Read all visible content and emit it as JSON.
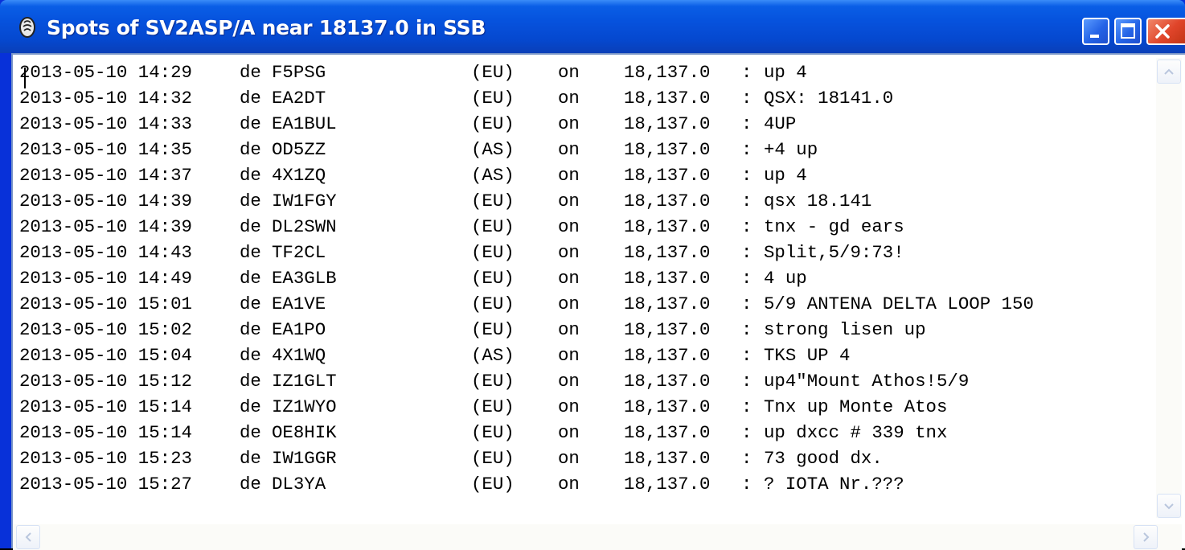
{
  "window": {
    "title": "Spots of SV2ASP/A near 18137.0 in SSB",
    "app_icon": "radio-cluster-icon",
    "controls": [
      "minimize-icon",
      "maximize-icon",
      "close-icon"
    ]
  },
  "spots": [
    {
      "datetime": "2013-05-10 14:29",
      "de": "de",
      "call": "F5PSG",
      "continent": "(EU)",
      "on": "on",
      "freq": "18,137.0",
      "sep": ":",
      "comment": "up 4"
    },
    {
      "datetime": "2013-05-10 14:32",
      "de": "de",
      "call": "EA2DT",
      "continent": "(EU)",
      "on": "on",
      "freq": "18,137.0",
      "sep": ":",
      "comment": "QSX: 18141.0"
    },
    {
      "datetime": "2013-05-10 14:33",
      "de": "de",
      "call": "EA1BUL",
      "continent": "(EU)",
      "on": "on",
      "freq": "18,137.0",
      "sep": ":",
      "comment": "4UP"
    },
    {
      "datetime": "2013-05-10 14:35",
      "de": "de",
      "call": "OD5ZZ",
      "continent": "(AS)",
      "on": "on",
      "freq": "18,137.0",
      "sep": ":",
      "comment": "+4 up"
    },
    {
      "datetime": "2013-05-10 14:37",
      "de": "de",
      "call": "4X1ZQ",
      "continent": "(AS)",
      "on": "on",
      "freq": "18,137.0",
      "sep": ":",
      "comment": "up 4"
    },
    {
      "datetime": "2013-05-10 14:39",
      "de": "de",
      "call": "IW1FGY",
      "continent": "(EU)",
      "on": "on",
      "freq": "18,137.0",
      "sep": ":",
      "comment": "qsx 18.141"
    },
    {
      "datetime": "2013-05-10 14:39",
      "de": "de",
      "call": "DL2SWN",
      "continent": "(EU)",
      "on": "on",
      "freq": "18,137.0",
      "sep": ":",
      "comment": "tnx - gd ears"
    },
    {
      "datetime": "2013-05-10 14:43",
      "de": "de",
      "call": "TF2CL",
      "continent": "(EU)",
      "on": "on",
      "freq": "18,137.0",
      "sep": ":",
      "comment": "Split,5/9:73!"
    },
    {
      "datetime": "2013-05-10 14:49",
      "de": "de",
      "call": "EA3GLB",
      "continent": "(EU)",
      "on": "on",
      "freq": "18,137.0",
      "sep": ":",
      "comment": "4 up"
    },
    {
      "datetime": "2013-05-10 15:01",
      "de": "de",
      "call": "EA1VE",
      "continent": "(EU)",
      "on": "on",
      "freq": "18,137.0",
      "sep": ":",
      "comment": "5/9 ANTENA DELTA LOOP 150"
    },
    {
      "datetime": "2013-05-10 15:02",
      "de": "de",
      "call": "EA1PO",
      "continent": "(EU)",
      "on": "on",
      "freq": "18,137.0",
      "sep": ":",
      "comment": "strong lisen up"
    },
    {
      "datetime": "2013-05-10 15:04",
      "de": "de",
      "call": "4X1WQ",
      "continent": "(AS)",
      "on": "on",
      "freq": "18,137.0",
      "sep": ":",
      "comment": "TKS UP 4"
    },
    {
      "datetime": "2013-05-10 15:12",
      "de": "de",
      "call": "IZ1GLT",
      "continent": "(EU)",
      "on": "on",
      "freq": "18,137.0",
      "sep": ":",
      "comment": "up4\"Mount Athos!5/9"
    },
    {
      "datetime": "2013-05-10 15:14",
      "de": "de",
      "call": "IZ1WYO",
      "continent": "(EU)",
      "on": "on",
      "freq": "18,137.0",
      "sep": ":",
      "comment": "Tnx up Monte Atos"
    },
    {
      "datetime": "2013-05-10 15:14",
      "de": "de",
      "call": "OE8HIK",
      "continent": "(EU)",
      "on": "on",
      "freq": "18,137.0",
      "sep": ":",
      "comment": "up dxcc # 339 tnx"
    },
    {
      "datetime": "2013-05-10 15:23",
      "de": "de",
      "call": "IW1GGR",
      "continent": "(EU)",
      "on": "on",
      "freq": "18,137.0",
      "sep": ":",
      "comment": "73 good dx."
    },
    {
      "datetime": "2013-05-10 15:27",
      "de": "de",
      "call": "DL3YA",
      "continent": "(EU)",
      "on": "on",
      "freq": "18,137.0",
      "sep": ":",
      "comment": "? IOTA Nr.???"
    }
  ],
  "scrollbars": {
    "vertical": [
      "scroll-up-icon",
      "scroll-down-icon"
    ],
    "horizontal": [
      "scroll-left-icon",
      "scroll-right-icon"
    ]
  }
}
